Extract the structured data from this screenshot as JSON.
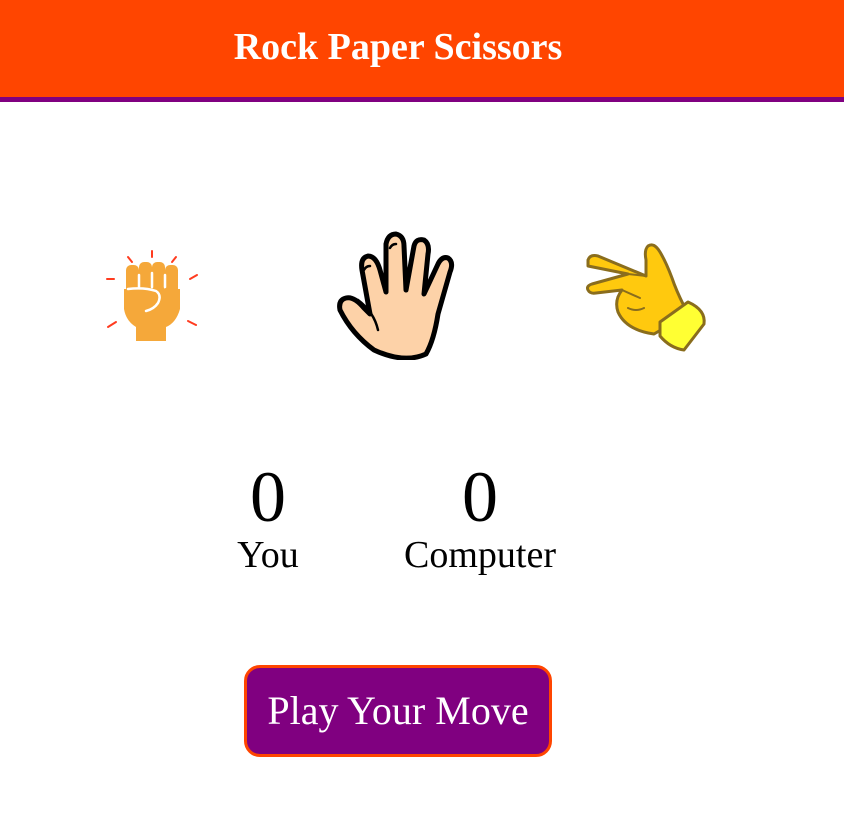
{
  "header": {
    "title": "Rock Paper Scissors",
    "color": "#ff4500",
    "border_color": "#800080"
  },
  "choices": [
    {
      "name": "rock",
      "icon": "raised-fist-icon"
    },
    {
      "name": "paper",
      "icon": "open-hand-icon"
    },
    {
      "name": "scissors",
      "icon": "victory-hand-icon"
    }
  ],
  "score": {
    "you": {
      "value": "0",
      "label": "You"
    },
    "computer": {
      "value": "0",
      "label": "Computer"
    }
  },
  "play_button": {
    "label": "Play Your Move",
    "background": "#800080",
    "border_color": "#ff4500"
  }
}
